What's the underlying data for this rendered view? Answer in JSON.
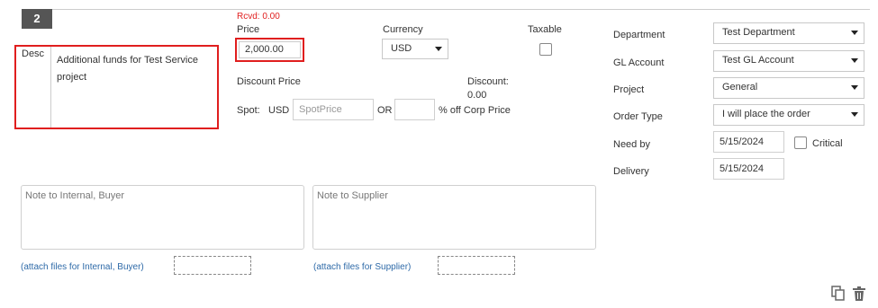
{
  "line": {
    "number": "2"
  },
  "desc": {
    "label": "Desc",
    "text": "Additional funds for Test Service project"
  },
  "price": {
    "rcvd": "Rcvd: 0.00",
    "label": "Price",
    "value": "2,000.00"
  },
  "currency": {
    "label": "Currency",
    "value": "USD"
  },
  "taxable": {
    "label": "Taxable"
  },
  "discount": {
    "label": "Discount Price",
    "spot_label": "Spot:",
    "currency": "USD",
    "spot_placeholder": "SpotPrice",
    "or": "OR",
    "percent_suffix": "% off Corp Price",
    "discount_label": "Discount:",
    "discount_value": "0.00"
  },
  "notes": {
    "internal_placeholder": "Note to Internal, Buyer",
    "supplier_placeholder": "Note to Supplier",
    "attach_internal": "(attach files for Internal, Buyer)",
    "attach_supplier": "(attach files for Supplier)"
  },
  "right": {
    "department": {
      "label": "Department",
      "value": "Test Department"
    },
    "gl_account": {
      "label": "GL Account",
      "value": "Test GL Account"
    },
    "project": {
      "label": "Project",
      "value": "General"
    },
    "order_type": {
      "label": "Order Type",
      "value": "I will place the order"
    },
    "need_by": {
      "label": "Need by",
      "value": "5/15/2024"
    },
    "critical": {
      "label": "Critical"
    },
    "delivery": {
      "label": "Delivery",
      "value": "5/15/2024"
    }
  },
  "icons": {
    "copy": "copy-icon",
    "trash": "trash-icon"
  }
}
